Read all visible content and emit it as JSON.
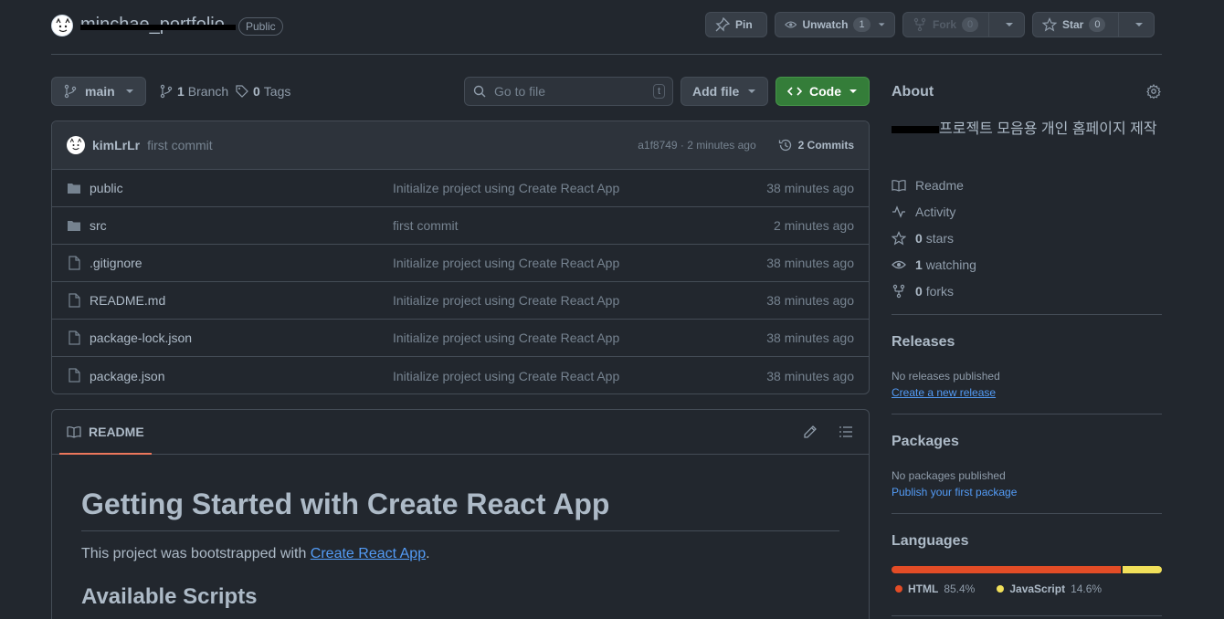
{
  "header": {
    "repo_name": "minchae_portfolio",
    "visibility": "Public",
    "pin_label": "Pin",
    "unwatch_label": "Unwatch",
    "watch_count": "1",
    "fork_label": "Fork",
    "fork_count": "0",
    "star_label": "Star",
    "star_count": "0"
  },
  "toolbar": {
    "branch": "main",
    "branch_count": "1",
    "branch_label": "Branch",
    "tag_count": "0",
    "tag_label": "Tags",
    "search_placeholder": "Go to file",
    "search_shortcut": "t",
    "add_file_label": "Add file",
    "code_label": "Code"
  },
  "commit": {
    "author": "kimLrLr",
    "message": "first commit",
    "hash_time": "a1f8749 · 2 minutes ago",
    "commits_label": "2 Commits"
  },
  "files": [
    {
      "type": "folder",
      "name": "public",
      "message": "Initialize project using Create React App",
      "time": "38 minutes ago"
    },
    {
      "type": "folder",
      "name": "src",
      "message": "first commit",
      "time": "2 minutes ago"
    },
    {
      "type": "file",
      "name": ".gitignore",
      "message": "Initialize project using Create React App",
      "time": "38 minutes ago"
    },
    {
      "type": "file",
      "name": "README.md",
      "message": "Initialize project using Create React App",
      "time": "38 minutes ago"
    },
    {
      "type": "file",
      "name": "package-lock.json",
      "message": "Initialize project using Create React App",
      "time": "38 minutes ago"
    },
    {
      "type": "file",
      "name": "package.json",
      "message": "Initialize project using Create React App",
      "time": "38 minutes ago"
    }
  ],
  "readme": {
    "tab_label": "README",
    "h1": "Getting Started with Create React App",
    "p_prefix": "This project was bootstrapped with ",
    "p_link": "Create React App",
    "p_suffix": ".",
    "h2": "Available Scripts"
  },
  "about": {
    "title": "About",
    "description": "프로젝트 모음용 개인 홈페이지 제작",
    "items": [
      {
        "icon": "book-icon",
        "label": "Readme",
        "count": ""
      },
      {
        "icon": "pulse-icon",
        "label": "Activity",
        "count": ""
      },
      {
        "icon": "star-icon",
        "label": "stars",
        "count": "0"
      },
      {
        "icon": "eye-icon",
        "label": "watching",
        "count": "1"
      },
      {
        "icon": "fork-icon",
        "label": "forks",
        "count": "0"
      }
    ]
  },
  "releases": {
    "title": "Releases",
    "empty": "No releases published",
    "link": "Create a new release"
  },
  "packages": {
    "title": "Packages",
    "empty": "No packages published",
    "link": "Publish your first package"
  },
  "languages": {
    "title": "Languages",
    "items": [
      {
        "name": "HTML",
        "percent": "85.4%",
        "value": 85.4,
        "color": "#e34c26"
      },
      {
        "name": "JavaScript",
        "percent": "14.6%",
        "value": 14.6,
        "color": "#f1e05a"
      }
    ]
  }
}
